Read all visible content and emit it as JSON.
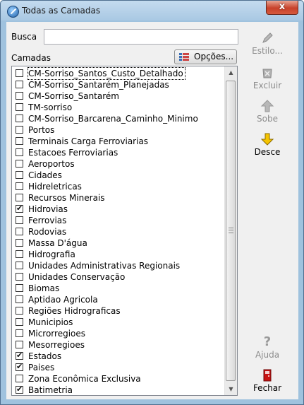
{
  "window": {
    "title": "Todas as Camadas",
    "close_glyph": "x"
  },
  "search": {
    "label": "Busca",
    "value": "",
    "placeholder": ""
  },
  "layers": {
    "label": "Camadas",
    "options_button": "Opções...",
    "items": [
      {
        "label": "CM-Sorriso_Santos_Custo_Detalhado",
        "checked": false,
        "focused": true
      },
      {
        "label": "CM-Sorriso_Santarém_Planejadas",
        "checked": false
      },
      {
        "label": "CM-Sorriso_Santarém",
        "checked": false
      },
      {
        "label": "TM-sorriso",
        "checked": false
      },
      {
        "label": "CM-Sorriso_Barcarena_Caminho_Minimo",
        "checked": false
      },
      {
        "label": "Portos",
        "checked": false
      },
      {
        "label": "Terminais Carga Ferroviarias",
        "checked": false
      },
      {
        "label": "Estacoes Ferroviarias",
        "checked": false
      },
      {
        "label": "Aeroportos",
        "checked": false
      },
      {
        "label": "Cidades",
        "checked": false
      },
      {
        "label": "Hidreletricas",
        "checked": false
      },
      {
        "label": "Recursos Minerais",
        "checked": false
      },
      {
        "label": "Hidrovias",
        "checked": true
      },
      {
        "label": "Ferrovias",
        "checked": false
      },
      {
        "label": "Rodovias",
        "checked": false
      },
      {
        "label": "Massa D'água",
        "checked": false
      },
      {
        "label": "Hidrografia",
        "checked": false
      },
      {
        "label": "Unidades Administrativas Regionais",
        "checked": false
      },
      {
        "label": "Unidades Conservação",
        "checked": false
      },
      {
        "label": "Biomas",
        "checked": false
      },
      {
        "label": "Aptidao Agricola",
        "checked": false
      },
      {
        "label": "Regiões Hidrograficas",
        "checked": false
      },
      {
        "label": "Municipios",
        "checked": false
      },
      {
        "label": "Microrregioes",
        "checked": false
      },
      {
        "label": "Mesorregioes",
        "checked": false
      },
      {
        "label": "Estados",
        "checked": true
      },
      {
        "label": "Paises",
        "checked": true
      },
      {
        "label": "Zona Econômica Exclusiva",
        "checked": false
      },
      {
        "label": "Batimetria",
        "checked": true
      }
    ]
  },
  "side_buttons": {
    "estilo": {
      "label": "Estilo...",
      "enabled": false,
      "icon": "pencil-icon"
    },
    "excluir": {
      "label": "Excluir",
      "enabled": false,
      "icon": "delete-icon"
    },
    "sobe": {
      "label": "Sobe",
      "enabled": false,
      "icon": "arrow-up-icon"
    },
    "desce": {
      "label": "Desce",
      "enabled": true,
      "icon": "arrow-down-icon"
    },
    "ajuda": {
      "label": "Ajuda",
      "enabled": false,
      "icon": "help-icon"
    },
    "fechar": {
      "label": "Fechar",
      "enabled": true,
      "icon": "exit-door-icon"
    }
  },
  "colors": {
    "accent_arrow": "#f5c400",
    "title_bar": "#b6d1ea",
    "close_button": "#c7412a",
    "exit_icon": "#c81414"
  }
}
